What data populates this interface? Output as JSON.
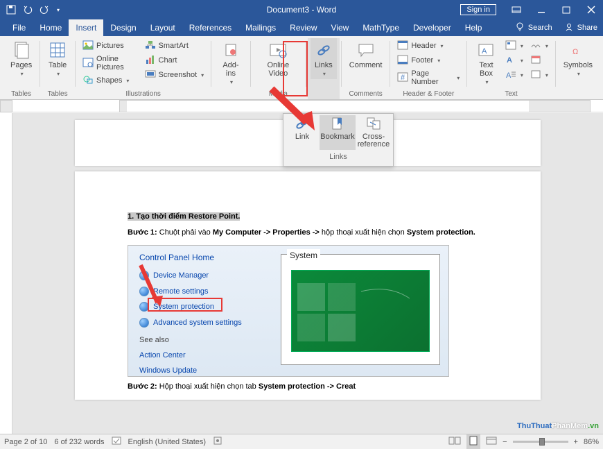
{
  "window": {
    "title": "Document3 - Word",
    "sign_in": "Sign in"
  },
  "tabs": [
    "File",
    "Home",
    "Insert",
    "Design",
    "Layout",
    "References",
    "Mailings",
    "Review",
    "View",
    "MathType",
    "Developer",
    "Help"
  ],
  "active_tab": 2,
  "tell_me": "Search",
  "share": "Share",
  "ribbon": {
    "pages": {
      "label": "Pages",
      "btn": "Pages"
    },
    "tables": {
      "label": "Tables",
      "btn": "Table"
    },
    "illustrations": {
      "label": "Illustrations",
      "items": [
        "Pictures",
        "Online Pictures",
        "Shapes",
        "SmartArt",
        "Chart",
        "Screenshot"
      ]
    },
    "addins": {
      "label": "",
      "btn": "Add-ins"
    },
    "media": {
      "label": "Media",
      "btn": "Online Video"
    },
    "links": {
      "label": "",
      "btn": "Links"
    },
    "comments": {
      "label": "Comments",
      "btn": "Comment"
    },
    "header_footer": {
      "label": "Header & Footer",
      "items": [
        "Header",
        "Footer",
        "Page Number"
      ]
    },
    "text": {
      "label": "Text",
      "btn": "Text Box"
    },
    "symbols": {
      "label": "",
      "btn": "Symbols"
    }
  },
  "dropdown": {
    "items": [
      "Link",
      "Bookmark",
      "Cross-reference"
    ],
    "label": "Links",
    "cross_l1": "Cross-",
    "cross_l2": "reference"
  },
  "document": {
    "heading": "1. Tạo thời điểm Restore Point.",
    "step1_b": "Bước 1:",
    "step1_t1": " Chuột phải vào ",
    "step1_b2": "My Computer -> Properties ->",
    "step1_t2": " hộp thoại xuất hiện chọn ",
    "step1_b3": "System protection.",
    "step2_b": "Bước 2:",
    "step2_t1": " Hộp thoại xuất hiện chọn tab ",
    "step2_b2": "System protection -> ",
    "step2_b3": "Creat",
    "cp_home": "Control Panel Home",
    "cp_items": [
      "Device Manager",
      "Remote settings",
      "System protection",
      "Advanced system settings"
    ],
    "see_also": "See also",
    "action_center": "Action Center",
    "win_update": "Windows Update",
    "system_label": "System"
  },
  "status": {
    "page": "Page 2 of 10",
    "words": "6 of 232 words",
    "lang": "English (United States)",
    "zoom": "86%"
  },
  "watermark": {
    "p1": "ThuThuat",
    "p2": "PhanMem",
    "p3": ".vn"
  }
}
